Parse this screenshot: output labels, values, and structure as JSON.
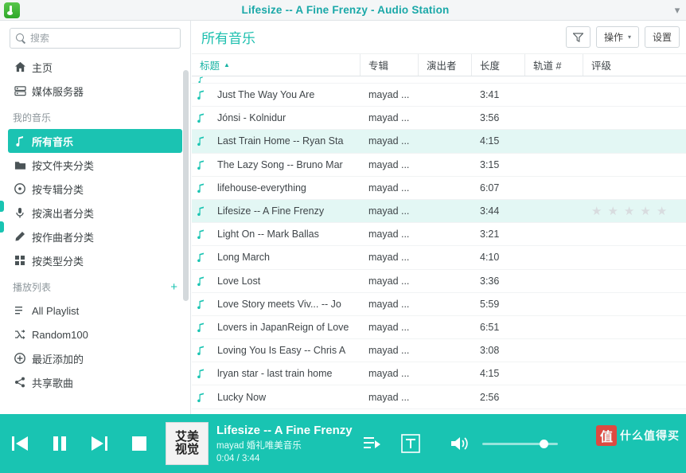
{
  "window": {
    "title": "Lifesize -- A Fine Frenzy - Audio Station",
    "logo_icon": "audio-station-logo",
    "right_icon": "window-menu-icon"
  },
  "sidebar": {
    "search": {
      "placeholder": "搜索",
      "value": "",
      "icon": "search-icon"
    },
    "top_items": [
      {
        "label": "主页",
        "icon": "home-icon"
      },
      {
        "label": "媒体服务器",
        "icon": "server-icon"
      }
    ],
    "my_music_label": "我的音乐",
    "music_items": [
      {
        "label": "所有音乐",
        "icon": "music-note-icon",
        "active": true
      },
      {
        "label": "按文件夹分类",
        "icon": "folder-icon",
        "active": false
      },
      {
        "label": "按专辑分类",
        "icon": "disc-icon",
        "active": false
      },
      {
        "label": "按演出者分类",
        "icon": "mic-icon",
        "active": false
      },
      {
        "label": "按作曲者分类",
        "icon": "pen-icon",
        "active": false
      },
      {
        "label": "按类型分类",
        "icon": "grid-icon",
        "active": false
      }
    ],
    "playlist_label": "播放列表",
    "playlist_add_icon": "plus-icon",
    "playlist_items": [
      {
        "label": "All Playlist",
        "icon": "list-icon"
      },
      {
        "label": "Random100",
        "icon": "shuffle-icon"
      },
      {
        "label": "最近添加的",
        "icon": "plus-circle-icon"
      },
      {
        "label": "共享歌曲",
        "icon": "share-icon"
      }
    ]
  },
  "main": {
    "title": "所有音乐",
    "toolbar": {
      "filter_icon": "filter-icon",
      "action_label": "操作",
      "action_caret": "▾",
      "settings_label": "设置"
    },
    "columns": [
      {
        "label": "标题",
        "sorted": true,
        "caret": "▲"
      },
      {
        "label": "专辑",
        "sorted": false,
        "caret": ""
      },
      {
        "label": "演出者",
        "sorted": false,
        "caret": ""
      },
      {
        "label": "长度",
        "sorted": false,
        "caret": ""
      },
      {
        "label": "轨道 #",
        "sorted": false,
        "caret": ""
      },
      {
        "label": "评级",
        "sorted": false,
        "caret": ""
      }
    ],
    "rows": [
      {
        "title": "Just The Way You Are",
        "album": "mayad ...",
        "artist": "",
        "length": "3:41",
        "track": "",
        "selected": false
      },
      {
        "title": "Jónsi - Kolnidur",
        "album": "mayad ...",
        "artist": "",
        "length": "3:56",
        "track": "",
        "selected": false
      },
      {
        "title": "Last Train Home -- Ryan Sta",
        "album": "mayad ...",
        "artist": "",
        "length": "4:15",
        "track": "",
        "selected": true
      },
      {
        "title": "The Lazy Song -- Bruno Mar",
        "album": "mayad ...",
        "artist": "",
        "length": "3:15",
        "track": "",
        "selected": false
      },
      {
        "title": "lifehouse-everything",
        "album": "mayad ...",
        "artist": "",
        "length": "6:07",
        "track": "",
        "selected": false
      },
      {
        "title": "Lifesize -- A Fine Frenzy",
        "album": "mayad ...",
        "artist": "",
        "length": "3:44",
        "track": "",
        "selected": true,
        "rating": 0
      },
      {
        "title": "Light On -- Mark Ballas",
        "album": "mayad ...",
        "artist": "",
        "length": "3:21",
        "track": "",
        "selected": false
      },
      {
        "title": "Long March",
        "album": "mayad ...",
        "artist": "",
        "length": "4:10",
        "track": "",
        "selected": false
      },
      {
        "title": "Love Lost",
        "album": "mayad ...",
        "artist": "",
        "length": "3:36",
        "track": "",
        "selected": false
      },
      {
        "title": "Love Story meets Viv... -- Jo",
        "album": "mayad ...",
        "artist": "",
        "length": "5:59",
        "track": "",
        "selected": false
      },
      {
        "title": "Lovers in JapanReign of Love",
        "album": "mayad ...",
        "artist": "",
        "length": "6:51",
        "track": "",
        "selected": false
      },
      {
        "title": "Loving You Is Easy -- Chris A",
        "album": "mayad ...",
        "artist": "",
        "length": "3:08",
        "track": "",
        "selected": false
      },
      {
        "title": "lryan star - last train home",
        "album": "mayad ...",
        "artist": "",
        "length": "4:15",
        "track": "",
        "selected": false
      },
      {
        "title": "Lucky Now",
        "album": "mayad ...",
        "artist": "",
        "length": "2:56",
        "track": "",
        "selected": false
      }
    ]
  },
  "player": {
    "prev_icon": "previous-track-icon",
    "pause_icon": "pause-icon",
    "next_icon": "next-track-icon",
    "stop_icon": "stop-icon",
    "album_art_text_1": "艾美",
    "album_art_text_2": "视觉",
    "now_playing_title": "Lifesize -- A Fine Frenzy",
    "now_playing_artist": "mayad 婚礼唯美音乐",
    "time_display": "0:04 / 3:44",
    "queue_icon": "playlist-queue-icon",
    "lyrics_icon": "lyrics-icon",
    "volume_icon": "volume-icon",
    "volume_percent": 76,
    "watermark_badge": "值",
    "watermark_text": "什么值得买"
  },
  "colors": {
    "accent": "#19c4b2",
    "title_text": "#1aa8a8",
    "selected_row": "#e3f7f4"
  }
}
